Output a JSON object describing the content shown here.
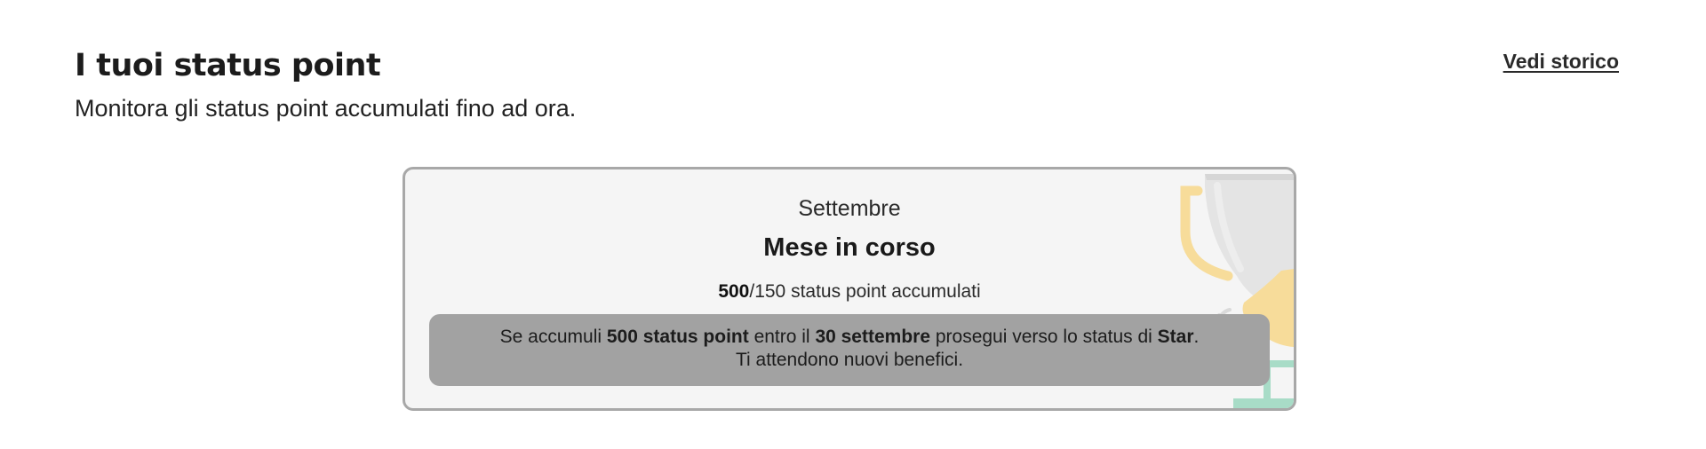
{
  "header": {
    "title": "I tuoi status point",
    "subtitle": "Monitora gli status point accumulati fino ad ora.",
    "history_link": "Vedi storico"
  },
  "card": {
    "month": "Settembre",
    "period_label": "Mese in corso",
    "points_current": "500",
    "points_suffix": "/150 status point accumulati",
    "notice": {
      "line1_prefix": "Se accumuli ",
      "line1_points": "500 status point",
      "line1_middle": " entro il ",
      "line1_date": "30 settembre",
      "line1_after": " prosegui verso lo status di ",
      "line1_status": "Star",
      "line1_end": ".",
      "line2": "Ti attendono nuovi benefici."
    },
    "trophy_icon": "trophy-icon"
  },
  "colors": {
    "card_background": "#f5f5f5",
    "card_border": "#a8a8a8",
    "notice_background": "#a2a2a2",
    "trophy_gold": "#f7dc9a",
    "trophy_silver": "#e3e3e3",
    "trophy_base": "#a8dcc7"
  }
}
